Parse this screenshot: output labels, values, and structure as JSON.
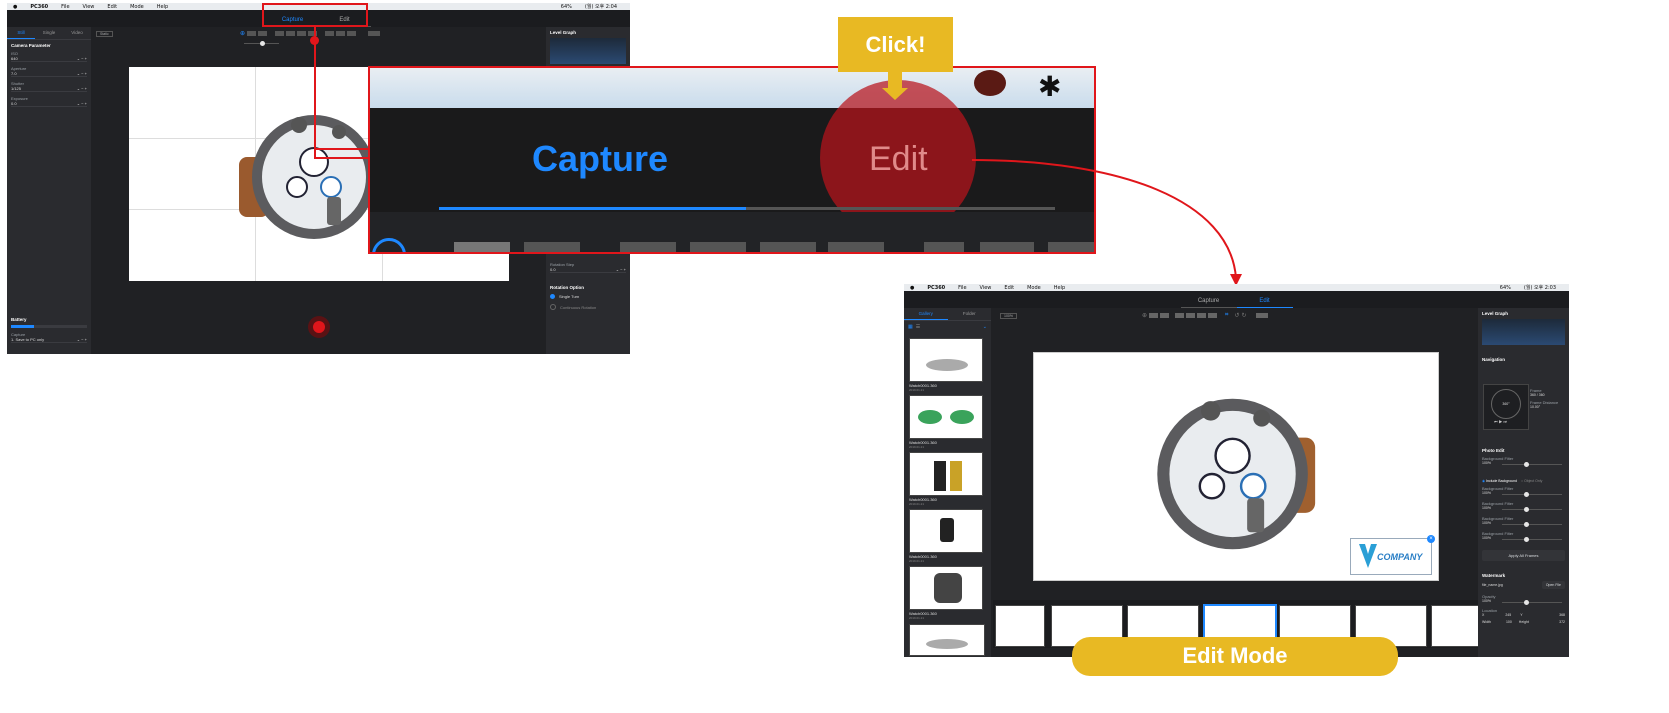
{
  "capture_window": {
    "menubar": {
      "apple": "",
      "app": "PC360",
      "items": [
        "File",
        "View",
        "Edit",
        "Mode",
        "Help"
      ],
      "status": [
        "64%",
        "(월) 오후 2:04"
      ]
    },
    "tabs": {
      "capture": "Capture",
      "edit": "Edit"
    },
    "left_tabs": [
      "Still",
      "Single",
      "Video"
    ],
    "section_title": "Camera Parameter",
    "params": [
      {
        "label": "ISO",
        "value": "640"
      },
      {
        "label": "Aperture",
        "value": "7.0"
      },
      {
        "label": "Shutter",
        "value": "1/125"
      },
      {
        "label": "Exposure",
        "value": "0.0"
      }
    ],
    "zoom_badge": "Static",
    "battery_title": "Battery",
    "battery_level": 0.3,
    "save_label": "Capture",
    "save_value": "1. Save to PC only",
    "right_title": "Level Graph",
    "rotation_step_label": "Rotation Step",
    "rotation_step_value": "0.0",
    "rotation_option_title": "Rotation Option",
    "rotation_options": [
      "Single Turn",
      "Continuous Rotation"
    ]
  },
  "callout": {
    "click_label": "Click!",
    "capture": "Capture",
    "edit": "Edit"
  },
  "edit_window": {
    "menubar": {
      "app": "PC360",
      "items": [
        "File",
        "View",
        "Edit",
        "Mode",
        "Help"
      ],
      "status": [
        "64%",
        "(월) 오후 2:03"
      ]
    },
    "tabs": {
      "capture": "Capture",
      "edit": "Edit"
    },
    "left_tabs": [
      "Gallery",
      "Folder"
    ],
    "zoom_badge": "100%",
    "gallery": [
      {
        "name": "Watch0001.360",
        "date": "2019.01.21"
      },
      {
        "name": "Watch0001.360",
        "date": "2019.01.21"
      },
      {
        "name": "Watch0001.360",
        "date": "2019.01.21"
      },
      {
        "name": "Watch0001.360",
        "date": "2019.01.21"
      },
      {
        "name": "Watch0001.360",
        "date": "2019.01.21"
      }
    ],
    "watermark_logo": "COMPANY",
    "right": {
      "level_graph": "Level Graph",
      "navigation": "Navigation",
      "frame_label": "Frame",
      "frame_value": "360 / 360",
      "frame_distance_label": "Frame Distance",
      "frame_distance_value": "10.00°",
      "dial_value": "360°",
      "photo_edit": "Photo Edit",
      "bg_filter": "Background Filter",
      "bg_value": "100%",
      "include_bg": "Include Background",
      "object_only": "Object Only",
      "apply_all": "Apply All Frames",
      "watermark": "Watermark",
      "file_name": "file_name.jpg",
      "open_file": "Open File",
      "opacity_label": "Opacity",
      "opacity_value": "100%",
      "location_label": "Location",
      "loc_x": "X",
      "loc_x_val": "245",
      "loc_y": "Y",
      "loc_y_val": "368",
      "width_label": "Width",
      "width_val": "100",
      "height_label": "Height",
      "height_val": "372"
    }
  },
  "edit_mode_label": "Edit Mode",
  "colors": {
    "accent": "#1e88ff",
    "highlight": "#e8b923",
    "red": "#e0161b"
  }
}
